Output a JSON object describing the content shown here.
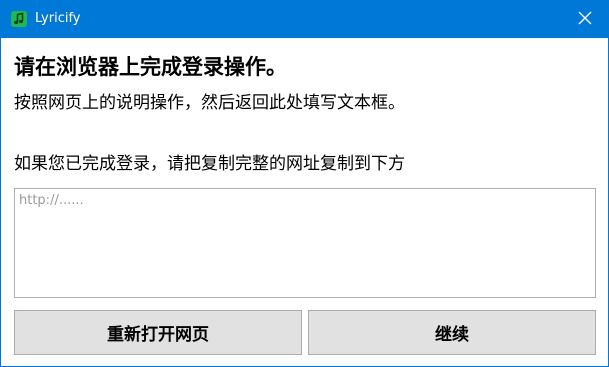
{
  "window": {
    "title": "Lyricify",
    "accent_color": "#0078d7",
    "app_icon": "music-note-icon",
    "close_icon": "close-icon"
  },
  "content": {
    "heading": "请在浏览器上完成登录操作。",
    "instruction": "按照网页上的说明操作，然后返回此处填写文本框。",
    "prompt": "如果您已完成登录，请把复制完整的网址复制到下方",
    "url_placeholder": "http://......",
    "url_value": ""
  },
  "buttons": {
    "reopen_label": "重新打开网页",
    "continue_label": "继续"
  }
}
